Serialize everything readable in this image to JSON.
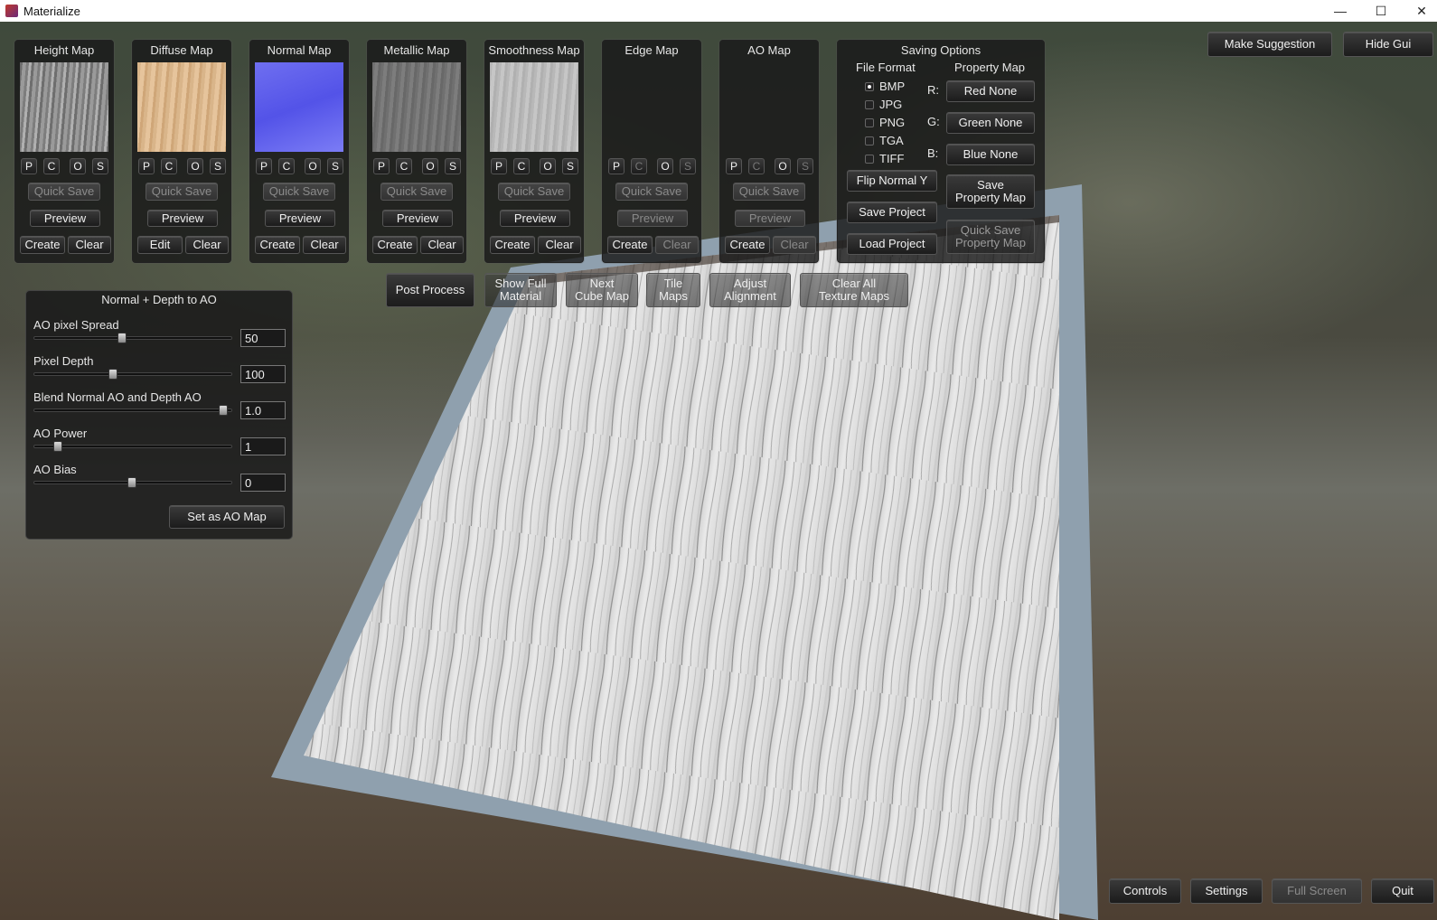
{
  "window": {
    "title": "Materialize",
    "minimize": "—",
    "maximize": "☐",
    "close": "✕"
  },
  "top_right": {
    "make_suggestion": "Make Suggestion",
    "hide_gui": "Hide Gui"
  },
  "maps": [
    {
      "title": "Height Map",
      "quick_save": "Quick Save",
      "preview": "Preview",
      "left_btn": "Create",
      "clear": "Clear",
      "p": "P",
      "c": "C",
      "o": "O",
      "s": "S"
    },
    {
      "title": "Diffuse Map",
      "quick_save": "Quick Save",
      "preview": "Preview",
      "left_btn": "Edit",
      "clear": "Clear",
      "p": "P",
      "c": "C",
      "o": "O",
      "s": "S"
    },
    {
      "title": "Normal Map",
      "quick_save": "Quick Save",
      "preview": "Preview",
      "left_btn": "Create",
      "clear": "Clear",
      "p": "P",
      "c": "C",
      "o": "O",
      "s": "S"
    },
    {
      "title": "Metallic Map",
      "quick_save": "Quick Save",
      "preview": "Preview",
      "left_btn": "Create",
      "clear": "Clear",
      "p": "P",
      "c": "C",
      "o": "O",
      "s": "S"
    },
    {
      "title": "Smoothness Map",
      "quick_save": "Quick Save",
      "preview": "Preview",
      "left_btn": "Create",
      "clear": "Clear",
      "p": "P",
      "c": "C",
      "o": "O",
      "s": "S"
    },
    {
      "title": "Edge Map",
      "quick_save": "Quick Save",
      "preview": "Preview",
      "left_btn": "Create",
      "clear": "Clear",
      "p": "P",
      "c": "C",
      "o": "O",
      "s": "S"
    },
    {
      "title": "AO Map",
      "quick_save": "Quick Save",
      "preview": "Preview",
      "left_btn": "Create",
      "clear": "Clear",
      "p": "P",
      "c": "C",
      "o": "O",
      "s": "S"
    }
  ],
  "saving": {
    "title": "Saving Options",
    "file_format_label": "File Format",
    "property_map_label": "Property Map",
    "formats": [
      "BMP",
      "JPG",
      "PNG",
      "TGA",
      "TIFF"
    ],
    "selected_format": "BMP",
    "r_label": "R:",
    "g_label": "G:",
    "b_label": "B:",
    "red": "Red None",
    "green": "Green None",
    "blue": "Blue None",
    "flip_normal_y": "Flip Normal Y",
    "save_property_map": "Save\nProperty Map",
    "save_project": "Save Project",
    "load_project": "Load Project",
    "quick_save_property_map": "Quick Save\nProperty Map"
  },
  "toolbar": {
    "post_process": "Post Process",
    "show_full_material": "Show Full\nMaterial",
    "next_cube_map": "Next\nCube Map",
    "tile_maps": "Tile\nMaps",
    "adjust_alignment": "Adjust\nAlignment",
    "clear_all_texture_maps": "Clear All\nTexture Maps"
  },
  "ao_panel": {
    "title": "Normal + Depth to AO",
    "sliders": [
      {
        "label": "AO pixel Spread",
        "value": "50",
        "fraction": 0.44
      },
      {
        "label": "Pixel Depth",
        "value": "100",
        "fraction": 0.39
      },
      {
        "label": "Blend Normal AO and Depth AO",
        "value": "1.0",
        "fraction": 0.97
      },
      {
        "label": "AO Power",
        "value": "1",
        "fraction": 0.1
      },
      {
        "label": "AO Bias",
        "value": "0",
        "fraction": 0.49
      }
    ],
    "set_as_ao_map": "Set as AO Map"
  },
  "bottom": {
    "controls": "Controls",
    "settings": "Settings",
    "full_screen": "Full Screen",
    "quit": "Quit"
  }
}
